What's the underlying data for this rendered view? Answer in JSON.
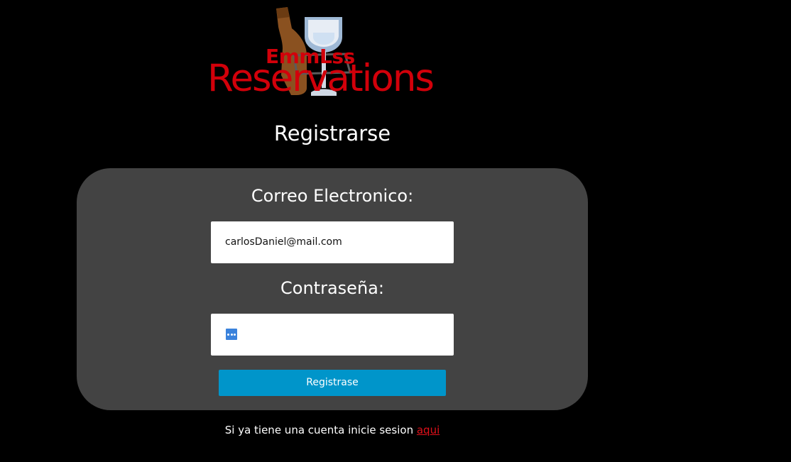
{
  "logo": {
    "brand_small": "EmmLss",
    "brand_big": "Reservations"
  },
  "page": {
    "title": "Registrarse"
  },
  "form": {
    "email_label": "Correo Electronico:",
    "email_value": "carlosDaniel@mail.com",
    "password_label": "Contraseña:",
    "password_icon": "password-key-icon",
    "submit_label": "Registrase"
  },
  "footer": {
    "prompt_text": "Si ya tiene una cuenta inicie sesion ",
    "link_text": "aqui"
  },
  "colors": {
    "background": "#000000",
    "panel": "#434343",
    "button": "#0095ca",
    "brand_red": "#d2000a",
    "link": "#e0101a"
  }
}
